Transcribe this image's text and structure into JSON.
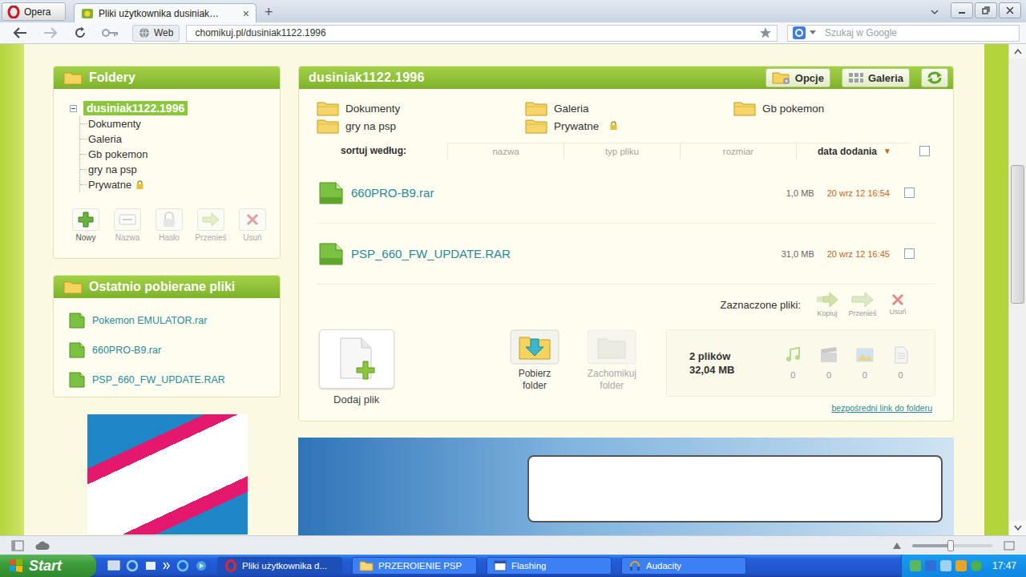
{
  "browser": {
    "menu_button": "Opera",
    "tabs": [
      {
        "label": "Pliki użytkownika dusiniak…",
        "selected": true,
        "close": "×"
      }
    ],
    "new_tab": "+",
    "mode_badge": "Web",
    "url": "chomikuj.pl/dusiniak1122.1996",
    "search_placeholder": "Szukaj w Google",
    "bookmarked": false
  },
  "sidebar": {
    "title": "Foldery",
    "root": {
      "label": "dusiniak1122.1996",
      "selected": true,
      "expanded": true
    },
    "folders": [
      {
        "label": "Dokumenty",
        "locked": false
      },
      {
        "label": "Galeria",
        "locked": false
      },
      {
        "label": "Gb pokemon",
        "locked": false
      },
      {
        "label": "gry na psp",
        "locked": false
      },
      {
        "label": "Prywatne",
        "locked": true
      }
    ],
    "tools": [
      {
        "label": "Nowy",
        "disabled": false,
        "kind": "new"
      },
      {
        "label": "Nazwa",
        "disabled": true,
        "kind": "rename"
      },
      {
        "label": "Hasło",
        "disabled": true,
        "kind": "password"
      },
      {
        "label": "Przenieś",
        "disabled": true,
        "kind": "move"
      },
      {
        "label": "Usuń",
        "disabled": true,
        "kind": "delete"
      }
    ]
  },
  "recent": {
    "title": "Ostatnio pobierane pliki",
    "items": [
      "Pokemon EMULATOR.rar",
      "660PRO-B9.rar",
      "PSP_660_FW_UPDATE.RAR"
    ]
  },
  "main": {
    "title": "dusiniak1122.1996",
    "header_buttons": [
      {
        "label": "Opcje",
        "kind": "options"
      },
      {
        "label": "Galeria",
        "kind": "gallery"
      }
    ],
    "folders": [
      {
        "label": "Dokumenty",
        "locked": false
      },
      {
        "label": "Galeria",
        "locked": false
      },
      {
        "label": "Gb pokemon",
        "locked": false
      },
      {
        "label": "gry na psp",
        "locked": false
      },
      {
        "label": "Prywatne",
        "locked": true
      }
    ],
    "sort": {
      "label": "sortuj według:",
      "arrow": "▼",
      "all_checked": false,
      "columns": [
        {
          "label": "nazwa",
          "selected": false
        },
        {
          "label": "typ pliku",
          "selected": false
        },
        {
          "label": "rozmiar",
          "selected": false
        },
        {
          "label": "data dodania",
          "selected": true
        }
      ]
    },
    "files": [
      {
        "name": "660PRO-B9.rar",
        "size": "1,0 MB",
        "date": "20 wrz 12 16:54",
        "checked": false
      },
      {
        "name": "PSP_660_FW_UPDATE.RAR",
        "size": "31,0 MB",
        "date": "20 wrz 12 16:45",
        "checked": false
      }
    ],
    "selection": {
      "label": "Zaznaczone pliki:",
      "actions": [
        {
          "label": "Kopiuj",
          "disabled": true,
          "kind": "copy"
        },
        {
          "label": "Przenieś",
          "disabled": true,
          "kind": "move"
        },
        {
          "label": "Usuń",
          "disabled": true,
          "kind": "delete"
        }
      ]
    },
    "actions": [
      {
        "label": "Dodaj plik",
        "disabled": false,
        "kind": "add"
      },
      {
        "label": "Pobierz folder",
        "disabled": false,
        "kind": "download"
      },
      {
        "label": "Zachomikuj folder",
        "disabled": true,
        "kind": "save"
      }
    ],
    "stats": {
      "files": "2 plików",
      "size": "32,04 MB",
      "counts": [
        {
          "kind": "music",
          "value": "0"
        },
        {
          "kind": "video",
          "value": "0"
        },
        {
          "kind": "image",
          "value": "0"
        },
        {
          "kind": "document",
          "value": "0"
        }
      ]
    },
    "direct_link": "bezpośredni link do folderu"
  },
  "scrollbar": {
    "position": 0.23,
    "thumb": 0.3
  },
  "statusbar": {
    "zoom": {
      "level": 0.48
    }
  },
  "taskbar": {
    "start": "Start",
    "tasks": [
      {
        "label": "Pliki użytkownika d...",
        "selected": true,
        "kind": "opera"
      },
      {
        "label": "PRZEROIENIE PSP",
        "selected": false,
        "kind": "folder"
      },
      {
        "label": "Flashing",
        "selected": false,
        "kind": "app"
      },
      {
        "label": "Audacity",
        "selected": false,
        "kind": "audacity"
      }
    ],
    "clock": "17:47"
  }
}
